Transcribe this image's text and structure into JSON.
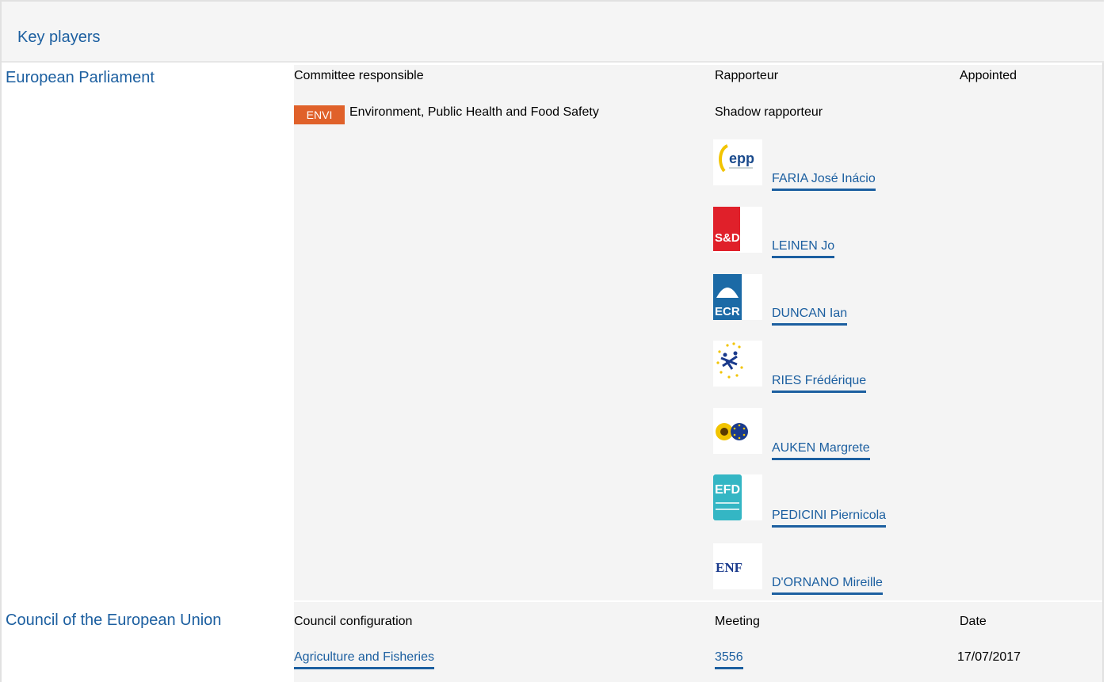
{
  "header": {
    "title": "Key players"
  },
  "parliament": {
    "label": "European Parliament",
    "committee_col": "Committee responsible",
    "rapporteur_col": "Rapporteur",
    "appointed_col": "Appointed",
    "committee_badge": "ENVI",
    "committee_name": "Environment, Public Health and Food Safety",
    "shadow_label": "Shadow rapporteur",
    "shadows": [
      {
        "name": "FARIA José Inácio",
        "group_icon": "epp-logo-icon",
        "logo_text": "epp"
      },
      {
        "name": "LEINEN Jo",
        "group_icon": "sd-logo-icon",
        "logo_text": "S&D"
      },
      {
        "name": "DUNCAN Ian",
        "group_icon": "ecr-logo-icon",
        "logo_text": "ECR"
      },
      {
        "name": "RIES Frédérique",
        "group_icon": "alde-logo-icon",
        "logo_text": ""
      },
      {
        "name": "AUKEN Margrete",
        "group_icon": "greens-efa-logo-icon",
        "logo_text": ""
      },
      {
        "name": "PEDICINI Piernicola",
        "group_icon": "efdd-logo-icon",
        "logo_text": "EFD"
      },
      {
        "name": "D'ORNANO Mireille",
        "group_icon": "enf-logo-icon",
        "logo_text": "ENF"
      }
    ]
  },
  "council": {
    "label": "Council of the European Union",
    "config_col": "Council configuration",
    "meeting_col": "Meeting",
    "date_col": "Date",
    "config_value": "Agriculture and Fisheries",
    "meeting_value": "3556",
    "date_value": "17/07/2017"
  },
  "colors": {
    "link": "#1c5fa0",
    "badge": "#e0612a",
    "header_bg": "#f5f5f5",
    "content_bg": "#f4f4f4"
  }
}
